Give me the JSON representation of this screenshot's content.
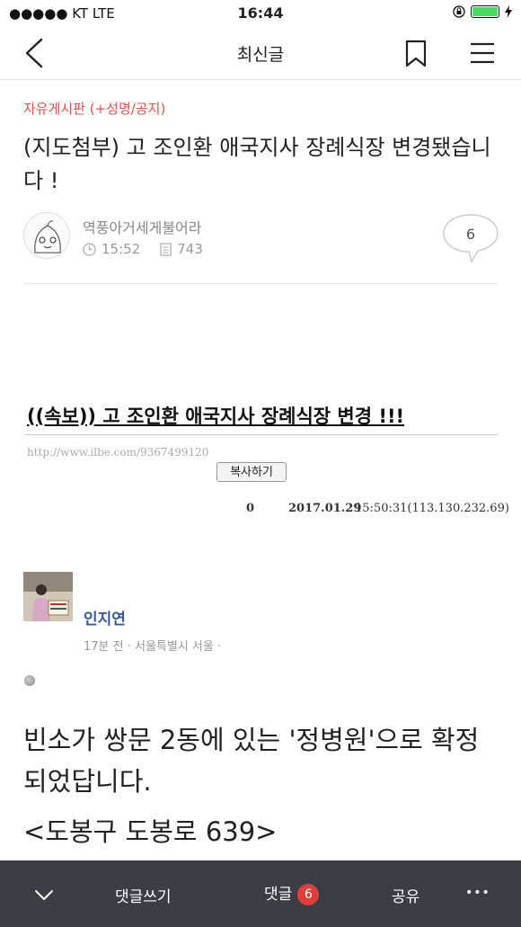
{
  "status_bar": {
    "carrier": "●●●●● KT   LTE",
    "time": "16:44",
    "battery_color": "#4cd964"
  },
  "navbar": {
    "title": "최신글",
    "back_icon": "chevron-left-icon",
    "bookmark_icon": "bookmark-icon",
    "menu_icon": "hamburger-icon"
  },
  "post": {
    "category": "자유게시판 (+성명/공지)",
    "title": "(지도첨부) 고 조인환 애국지사 장례식장 변경됐습니다 !",
    "author": "역풍아거세게불어라",
    "time": "15:52",
    "views": "743",
    "comment_count": "6",
    "category_color": "#e0524a"
  },
  "content": {
    "breaking_headline": "((속보)) 고 조인환 애국지사 장례식장 변경 !!!",
    "url": "http://www.ilbe.com/9367499120",
    "copy_button": "복사하기",
    "recommend_count": "0",
    "date": "2017.01.29",
    "time_ip": "15:50:31(113.130.232.69)"
  },
  "fb_post": {
    "name": "인지연",
    "sub": "17분 전 · 서울특별시 서울 ·",
    "body": "빈소가 쌍문 2동에 있는 '정병원'으로 확정되었답니다.",
    "address": "<도봉구 도봉로 639>"
  },
  "bottom_bar": {
    "collapse_icon": "chevron-down-icon",
    "write_comment": "댓글쓰기",
    "comments": "댓글",
    "comments_badge": "6",
    "share": "공유",
    "more": "•••"
  }
}
